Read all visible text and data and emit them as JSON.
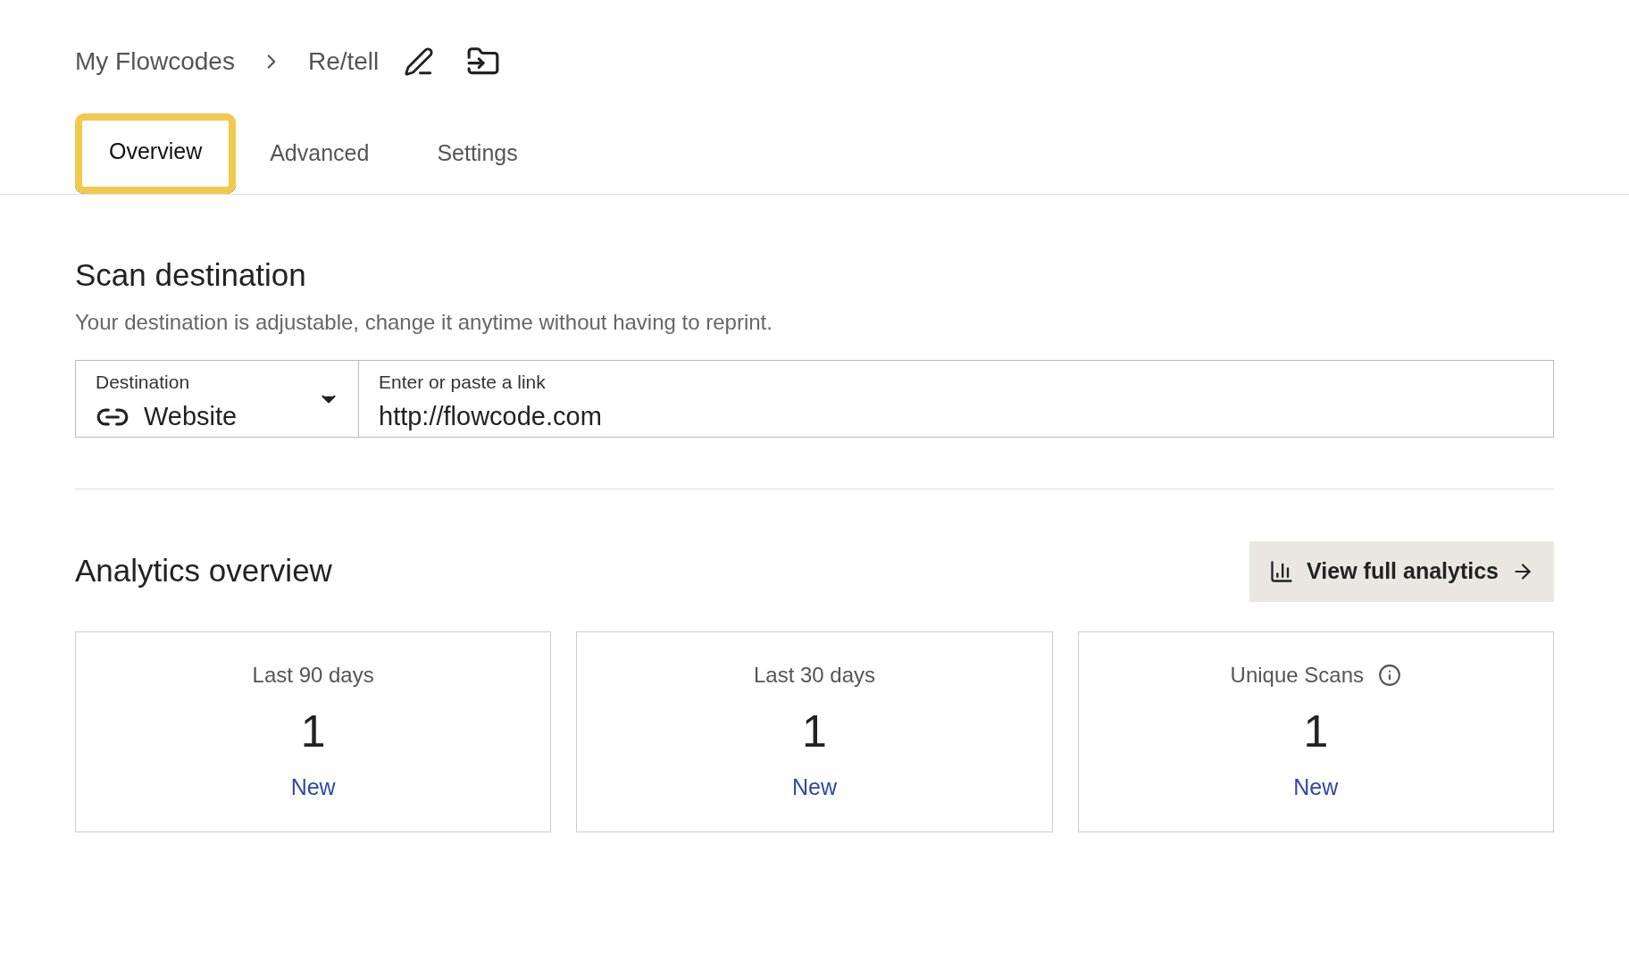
{
  "breadcrumb": [
    {
      "label": "My Flowcodes"
    },
    {
      "label": "Re/tell"
    }
  ],
  "tabs": [
    {
      "label": "Overview",
      "selected": true,
      "focused": true
    },
    {
      "label": "Advanced",
      "selected": false,
      "focused": false
    },
    {
      "label": "Settings",
      "selected": false,
      "focused": false
    }
  ],
  "scan_destination": {
    "title": "Scan destination",
    "subtitle": "Your destination is adjustable, change it anytime without having to reprint.",
    "destination": {
      "label": "Destination",
      "value": "Website"
    },
    "link": {
      "label": "Enter or paste a link",
      "value": "http://flowcode.com"
    }
  },
  "analytics": {
    "title": "Analytics overview",
    "button": "View full analytics",
    "cards": [
      {
        "label": "Last 90 days",
        "value": "1",
        "note": "New",
        "info": false
      },
      {
        "label": "Last 30 days",
        "value": "1",
        "note": "New",
        "info": false
      },
      {
        "label": "Unique Scans",
        "value": "1",
        "note": "New",
        "info": true
      }
    ]
  }
}
